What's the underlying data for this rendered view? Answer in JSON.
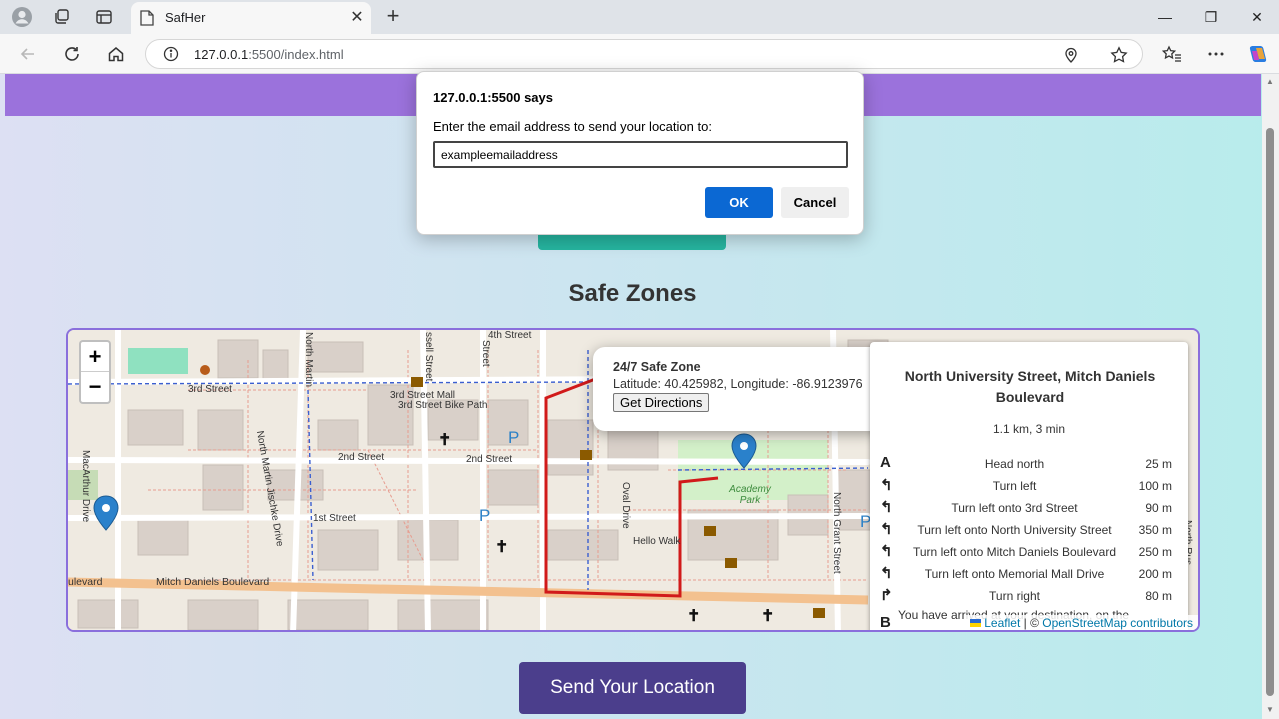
{
  "browser": {
    "tab_title": "SafHer",
    "url_host": "127.0.0.1",
    "url_rest": ":5500/index.html",
    "new_tab_glyph": "+",
    "close_tab_glyph": "✕",
    "icons": [
      "profile-icon",
      "workspaces-icon",
      "tab-actions-icon",
      "back-icon",
      "refresh-icon",
      "home-icon",
      "site-info-icon",
      "location-icon",
      "favorite-star-icon",
      "favorites-icon",
      "more-icon",
      "copilot-icon",
      "minimize-icon",
      "restore-icon",
      "close-window-icon"
    ],
    "window_controls": {
      "minimize": "—",
      "restore": "❐",
      "close": "✕"
    }
  },
  "page": {
    "section_title": "Safe Zones",
    "send_location_label": "Send Your Location",
    "header_color": "#9b72dc",
    "button_color": "#4b3e8c",
    "accent_teal": "#26b5a0"
  },
  "map": {
    "zoom_in": "+",
    "zoom_out": "−",
    "street_labels": [
      "4th Street",
      "3rd Street",
      "3rd Street Mall",
      "3rd Street Bike Path",
      "2nd Street",
      "2nd Street",
      "1st Street",
      "Mitch Daniels Boulevard",
      "ulevard",
      "MacArthur Drive",
      "North Martin",
      "North Martin Jischke Drive",
      "Oval Drive",
      "Hello Walk",
      "North Grant Street",
      "Academy Park",
      "North Rus",
      "ssell Street",
      "Street"
    ],
    "poi_glyphs": {
      "parking": "P",
      "place_of_worship": "✝"
    },
    "popup": {
      "title": "24/7 Safe Zone",
      "coords": "Latitude: 40.425982, Longitude: -86.9123976",
      "button": "Get Directions"
    },
    "routing": {
      "title": "North University Street, Mitch Daniels Boulevard",
      "summary": "1.1 km, 3 min",
      "start_marker": "A",
      "end_marker": "B",
      "instructions": [
        {
          "icon": "",
          "text": "Head north",
          "distance": "25 m"
        },
        {
          "icon": "↰",
          "text": "Turn left",
          "distance": "100 m"
        },
        {
          "icon": "↰",
          "text": "Turn left onto 3rd Street",
          "distance": "90 m"
        },
        {
          "icon": "↰",
          "text": "Turn left onto North University Street",
          "distance": "350 m"
        },
        {
          "icon": "↰",
          "text": "Turn left onto Mitch Daniels Boulevard",
          "distance": "250 m"
        },
        {
          "icon": "↰",
          "text": "Turn left onto Memorial Mall Drive",
          "distance": "200 m"
        },
        {
          "icon": "↱",
          "text": "Turn right",
          "distance": "80 m"
        }
      ],
      "arrival": "You have arrived at your destination, on the"
    },
    "attribution": {
      "leaflet": "Leaflet",
      "sep": " | © ",
      "osm": "OpenStreetMap contributors"
    },
    "route_color": "#d11a1a"
  },
  "dialog": {
    "title": "127.0.0.1:5500 says",
    "message": "Enter the email address to send your location to:",
    "input_value": "exampleemailaddress",
    "ok_label": "OK",
    "cancel_label": "Cancel"
  }
}
